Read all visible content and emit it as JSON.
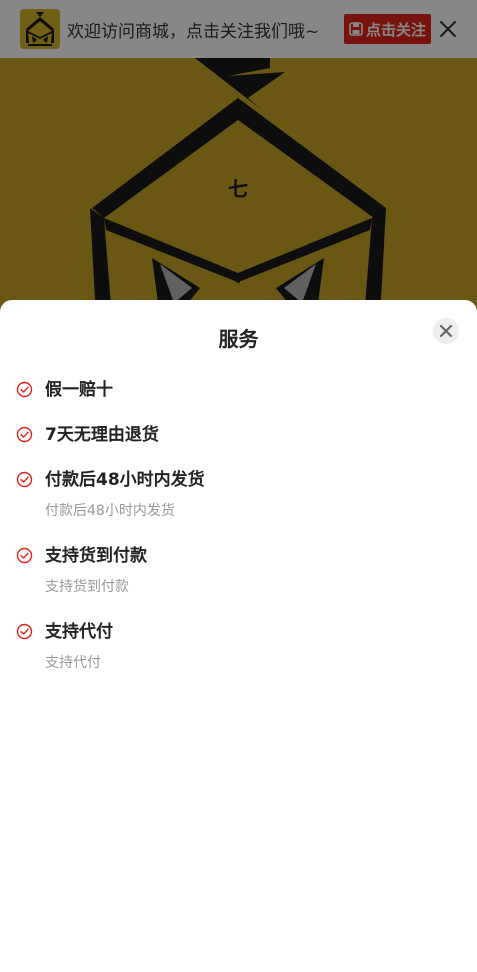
{
  "topbar": {
    "welcome_text": "欢迎访问商城，点击关注我们哦~",
    "follow_label": "点击关注"
  },
  "sheet": {
    "title": "服务",
    "items": [
      {
        "name": "假一赔十",
        "desc": ""
      },
      {
        "name": "7天无理由退货",
        "desc": ""
      },
      {
        "name": "付款后48小时内发货",
        "desc": "付款后48小时内发货"
      },
      {
        "name": "支持货到付款",
        "desc": "支持货到付款"
      },
      {
        "name": "支持代付",
        "desc": "支持代付"
      }
    ]
  },
  "hero": {
    "glyph": "七"
  },
  "colors": {
    "accent": "#e2231a",
    "hero_bg": "#c9a526",
    "check": "#e2231a"
  }
}
